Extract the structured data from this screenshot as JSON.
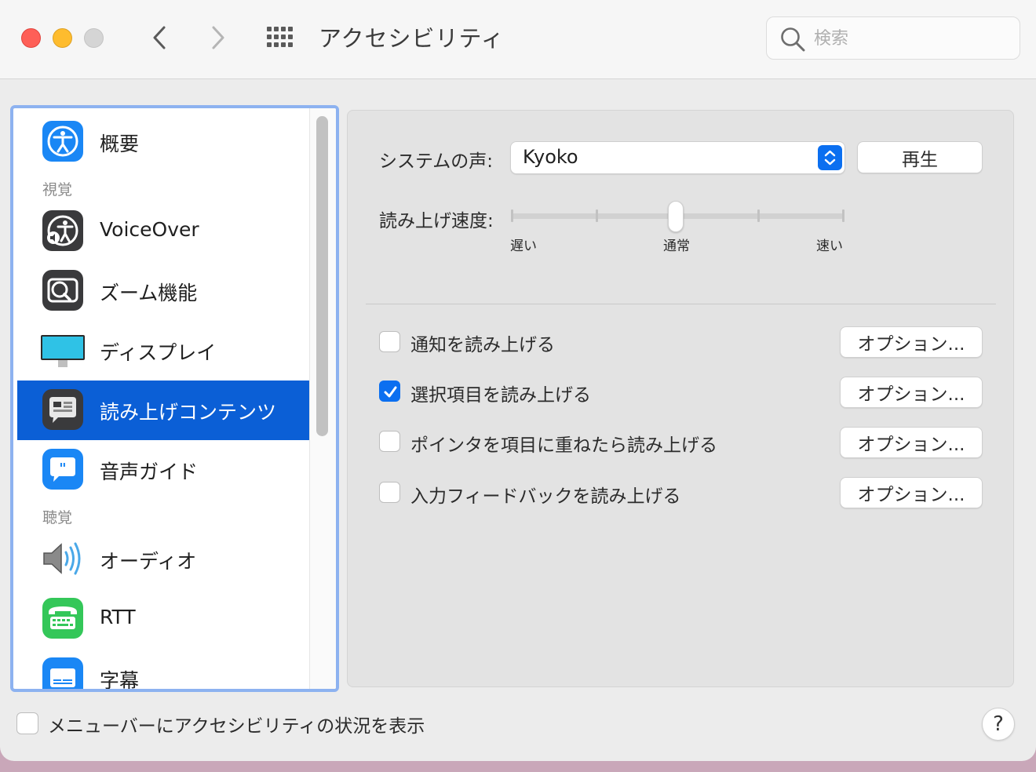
{
  "window": {
    "title": "アクセシビリティ"
  },
  "search": {
    "placeholder": "検索",
    "value": ""
  },
  "sidebar": {
    "items": [
      {
        "label": "概要",
        "icon": "accessibility-icon"
      },
      {
        "label": "VoiceOver",
        "icon": "voiceover-icon"
      },
      {
        "label": "ズーム機能",
        "icon": "zoom-icon"
      },
      {
        "label": "ディスプレイ",
        "icon": "display-icon"
      },
      {
        "label": "読み上げコンテンツ",
        "icon": "spoken-content-icon",
        "selected": true
      },
      {
        "label": "音声ガイド",
        "icon": "descriptions-icon"
      },
      {
        "label": "オーディオ",
        "icon": "audio-icon"
      },
      {
        "label": "RTT",
        "icon": "rtt-icon"
      },
      {
        "label": "字幕",
        "icon": "captions-icon"
      }
    ],
    "sections": {
      "vision": "視覚",
      "hearing": "聴覚"
    }
  },
  "main": {
    "system_voice_label": "システムの声:",
    "system_voice_value": "Kyoko",
    "play_button": "再生",
    "speaking_rate_label": "読み上げ速度:",
    "speaking_rate_value": 0.5,
    "rate_ticks": {
      "slow": "遅い",
      "normal": "通常",
      "fast": "速い"
    },
    "options": [
      {
        "label": "通知を読み上げる",
        "checked": false,
        "button": "オプション..."
      },
      {
        "label": "選択項目を読み上げる",
        "checked": true,
        "button": "オプション..."
      },
      {
        "label": "ポインタを項目に重ねたら読み上げる",
        "checked": false,
        "button": "オプション..."
      },
      {
        "label": "入力フィードバックを読み上げる",
        "checked": false,
        "button": "オプション..."
      }
    ]
  },
  "footer": {
    "show_status_label": "メニューバーにアクセシビリティの状況を表示",
    "show_status_checked": false,
    "help_label": "?"
  },
  "colors": {
    "accent": "#0b6ff0",
    "selection": "#0b5fd6",
    "focus_ring": "#8db2f0"
  }
}
